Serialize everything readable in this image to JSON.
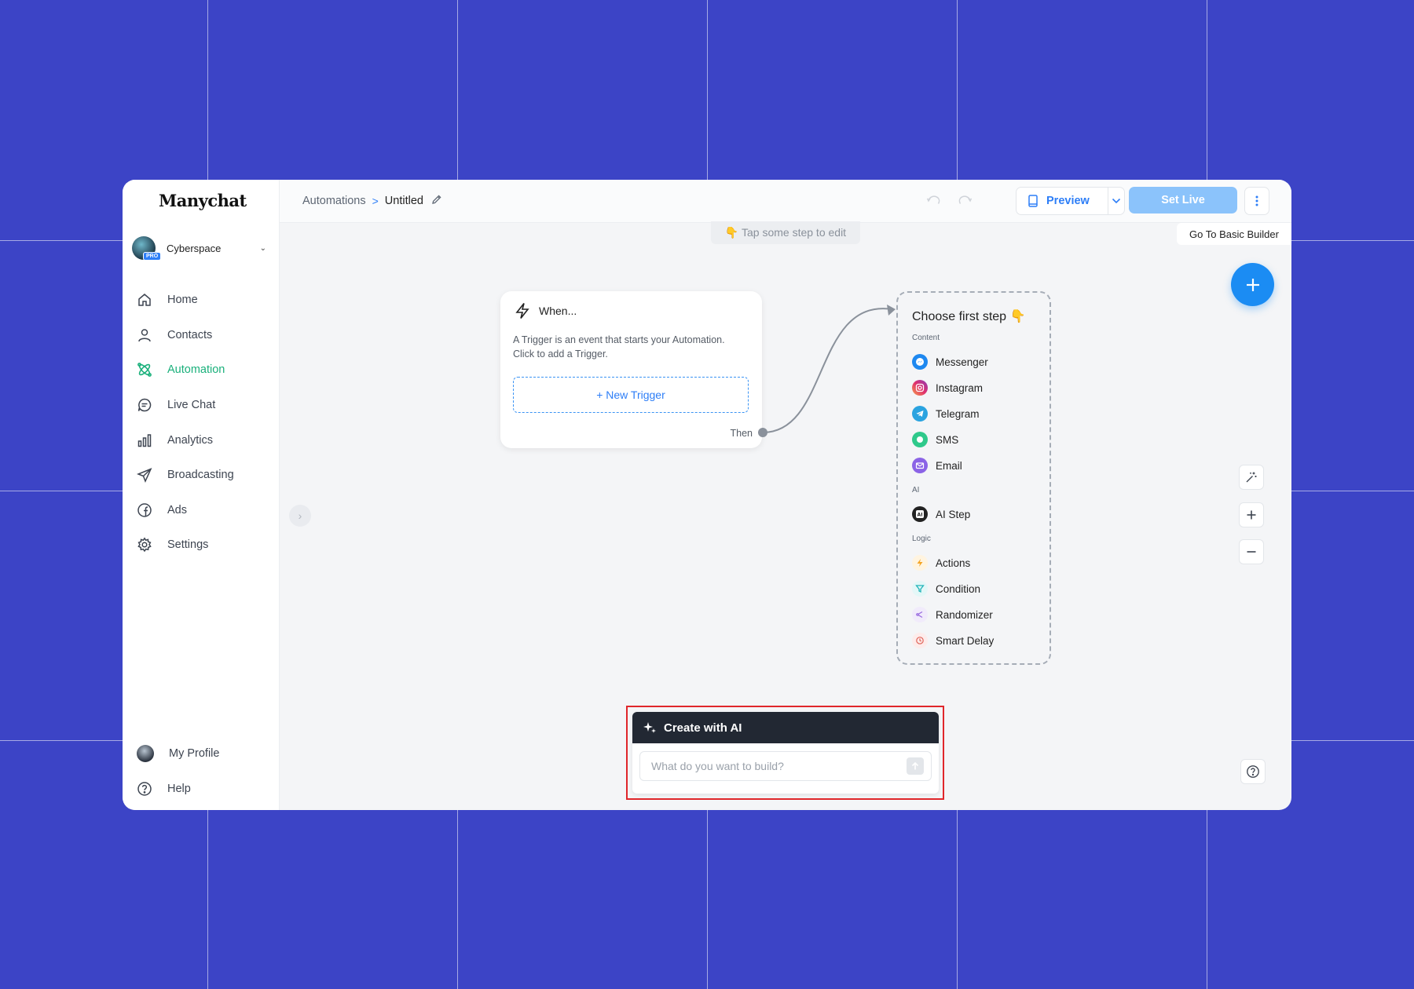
{
  "app": {
    "logo": "Manychat"
  },
  "account": {
    "name": "Cyberspace",
    "badge": "PRO"
  },
  "sidebar": {
    "items": [
      {
        "label": "Home",
        "icon": "home-icon"
      },
      {
        "label": "Contacts",
        "icon": "user-icon"
      },
      {
        "label": "Automation",
        "icon": "automation-icon",
        "active": true
      },
      {
        "label": "Live Chat",
        "icon": "chat-icon"
      },
      {
        "label": "Analytics",
        "icon": "bar-chart-icon"
      },
      {
        "label": "Broadcasting",
        "icon": "send-icon"
      },
      {
        "label": "Ads",
        "icon": "facebook-icon"
      },
      {
        "label": "Settings",
        "icon": "gear-icon"
      }
    ],
    "bottom": [
      {
        "label": "My Profile",
        "icon": "profile-avatar"
      },
      {
        "label": "Help",
        "icon": "help-icon"
      }
    ]
  },
  "header": {
    "breadcrumb": {
      "root": "Automations",
      "separator": ">",
      "current": "Untitled"
    },
    "preview_label": "Preview",
    "set_live_label": "Set Live"
  },
  "canvas": {
    "hint": "👇 Tap some step to edit",
    "basic_builder_label": "Go To Basic Builder",
    "trigger_card": {
      "title": "When...",
      "description": "A Trigger is an event that starts your Automation. Click to add a Trigger.",
      "new_trigger_label": "+ New Trigger",
      "then_label": "Then"
    },
    "first_step": {
      "title": "Choose first step 👇",
      "sections": [
        {
          "label": "Content",
          "items": [
            "Messenger",
            "Instagram",
            "Telegram",
            "SMS",
            "Email"
          ]
        },
        {
          "label": "AI",
          "items": [
            "AI Step"
          ]
        },
        {
          "label": "Logic",
          "items": [
            "Actions",
            "Condition",
            "Randomizer",
            "Smart Delay"
          ]
        }
      ]
    }
  },
  "ai_panel": {
    "title": "Create with AI",
    "placeholder": "What do you want to build?"
  },
  "colors": {
    "background": "#3c44c6",
    "accent_blue": "#2d7ef7",
    "active_green": "#1ab07b",
    "set_live_bg": "#8bc3fb",
    "highlight_red": "#e0262b",
    "ai_header_bg": "#222833"
  }
}
